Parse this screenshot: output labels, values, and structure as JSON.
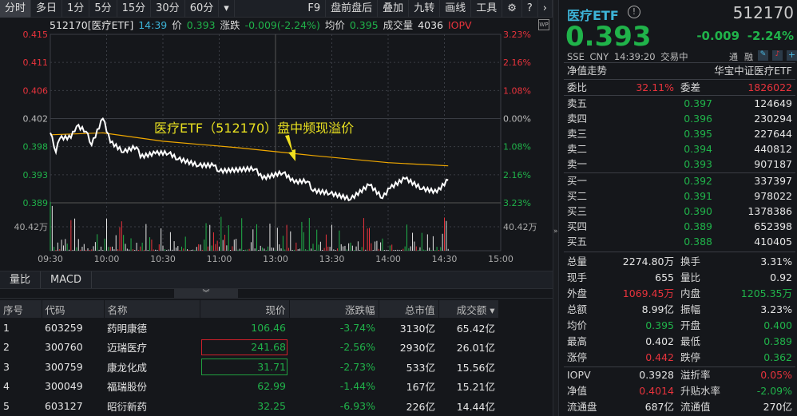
{
  "toolbar": {
    "tabs": [
      "分时",
      "多日",
      "1分",
      "5分",
      "15分",
      "30分",
      "60分"
    ],
    "more": "▾",
    "right": [
      "F9",
      "盘前盘后",
      "叠加",
      "九转",
      "画线",
      "工具"
    ]
  },
  "infobar": {
    "code": "512170[医疗ETF]",
    "time": "14:39",
    "price_label": "价",
    "price": "0.393",
    "change_label": "涨跌",
    "change": "-0.009(-2.24%)",
    "avg_label": "均价",
    "avg": "0.395",
    "vol_label": "成交量",
    "vol": "4036",
    "iopv": "IOPV",
    "wp": "WP"
  },
  "chart_data": {
    "type": "line",
    "title": "",
    "left_ticks": [
      "0.415",
      "0.411",
      "0.406",
      "0.402",
      "0.398",
      "0.393",
      "0.389"
    ],
    "right_ticks": [
      "3.23%",
      "2.16%",
      "1.08%",
      "0.00%",
      "1.08%",
      "2.16%",
      "3.23%"
    ],
    "ylim": [
      0.389,
      0.415
    ],
    "prev_close": 0.402,
    "volume_tick": "40.42万",
    "x_ticks": [
      "09:30",
      "10:00",
      "10:30",
      "11:00",
      "13:00",
      "13:30",
      "14:00",
      "14:30",
      "15:00"
    ],
    "annotation": "医疗ETF（512170）盘中频现溢价",
    "price": [
      [
        0,
        0.3998
      ],
      [
        3,
        0.3968
      ],
      [
        5,
        0.3989
      ],
      [
        11,
        0.399
      ],
      [
        14,
        0.4008
      ],
      [
        19,
        0.4
      ],
      [
        22,
        0.3979
      ],
      [
        28,
        0.402
      ],
      [
        32,
        0.3983
      ],
      [
        39,
        0.3968
      ],
      [
        46,
        0.3976
      ],
      [
        48,
        0.396
      ],
      [
        56,
        0.3966
      ],
      [
        63,
        0.3966
      ],
      [
        68,
        0.3957
      ],
      [
        79,
        0.3947
      ],
      [
        87,
        0.3947
      ],
      [
        90,
        0.3938
      ],
      [
        109,
        0.3942
      ],
      [
        113,
        0.3927
      ],
      [
        124,
        0.3936
      ],
      [
        130,
        0.3921
      ],
      [
        137,
        0.3923
      ],
      [
        140,
        0.3908
      ],
      [
        149,
        0.3904
      ],
      [
        160,
        0.3895
      ],
      [
        170,
        0.3917
      ],
      [
        177,
        0.3897
      ],
      [
        181,
        0.3912
      ],
      [
        189,
        0.3927
      ],
      [
        198,
        0.3911
      ],
      [
        206,
        0.3906
      ],
      [
        212,
        0.3925
      ]
    ],
    "avg": [
      [
        0,
        0.3995
      ],
      [
        28,
        0.3998
      ],
      [
        60,
        0.3985
      ],
      [
        100,
        0.3975
      ],
      [
        140,
        0.3963
      ],
      [
        180,
        0.3952
      ],
      [
        212,
        0.3947
      ]
    ]
  },
  "tabs2": [
    "量比",
    "MACD"
  ],
  "table": {
    "headers": [
      "序号",
      "代码",
      "名称",
      "现价",
      "涨跌幅",
      "总市值",
      "成交额 ▾"
    ],
    "rows": [
      [
        "1",
        "603259",
        "药明康德",
        "106.46",
        "-3.74%",
        "3130亿",
        "65.42亿"
      ],
      [
        "2",
        "300760",
        "迈瑞医疗",
        "241.68",
        "-2.56%",
        "2930亿",
        "26.01亿"
      ],
      [
        "3",
        "300759",
        "康龙化成",
        "31.71",
        "-2.73%",
        "533亿",
        "15.56亿"
      ],
      [
        "4",
        "300049",
        "福瑞股份",
        "62.99",
        "-1.44%",
        "167亿",
        "15.21亿"
      ],
      [
        "5",
        "603127",
        "昭衍新药",
        "32.25",
        "-6.93%",
        "226亿",
        "14.44亿"
      ]
    ]
  },
  "quote": {
    "name": "医疗ETF",
    "code": "512170",
    "price": "0.393",
    "change": "-0.009",
    "pct": "-2.24%",
    "exchange": "SSE",
    "currency": "CNY",
    "time": "14:39:20",
    "status": "交易中",
    "tag1": "通",
    "tag2": "融",
    "nav_trend": "净值走势",
    "fund_name": "华宝中证医疗ETF",
    "wb_label": "委比",
    "wb": "32.11%",
    "wc_label": "委差",
    "wc": "1826022"
  },
  "asks": [
    [
      "卖五",
      "0.397",
      "124649"
    ],
    [
      "卖四",
      "0.396",
      "230294"
    ],
    [
      "卖三",
      "0.395",
      "227644"
    ],
    [
      "卖二",
      "0.394",
      "440812"
    ],
    [
      "卖一",
      "0.393",
      "907187"
    ]
  ],
  "bids": [
    [
      "买一",
      "0.392",
      "337397"
    ],
    [
      "买二",
      "0.391",
      "978022"
    ],
    [
      "买三",
      "0.390",
      "1378386"
    ],
    [
      "买四",
      "0.389",
      "652398"
    ],
    [
      "买五",
      "0.388",
      "410405"
    ]
  ],
  "stats": [
    [
      "总量",
      "2274.80万",
      "w",
      "换手",
      "3.31%",
      "w"
    ],
    [
      "现手",
      "655",
      "w",
      "量比",
      "0.92",
      "w"
    ],
    [
      "外盘",
      "1069.45万",
      "r",
      "内盘",
      "1205.35万",
      "g"
    ],
    [
      "总额",
      "8.99亿",
      "w",
      "振幅",
      "3.23%",
      "w"
    ],
    [
      "均价",
      "0.395",
      "g",
      "开盘",
      "0.400",
      "g"
    ],
    [
      "最高",
      "0.402",
      "w",
      "最低",
      "0.389",
      "g"
    ],
    [
      "涨停",
      "0.442",
      "r",
      "跌停",
      "0.362",
      "g"
    ]
  ],
  "stats2": [
    [
      "IOPV",
      "0.3928",
      "w",
      "溢折率",
      "0.05%",
      "r"
    ],
    [
      "净值",
      "0.4014",
      "r",
      "升贴水率",
      "-2.09%",
      "g"
    ],
    [
      "流通盘",
      "687亿",
      "w",
      "流通值",
      "270亿",
      "w"
    ]
  ]
}
